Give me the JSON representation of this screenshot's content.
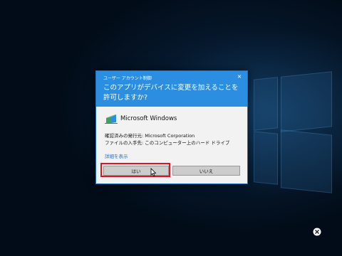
{
  "dialog": {
    "title": "ユーザー アカウント制御",
    "close_label": "×",
    "question": "このアプリがデバイスに変更を加えることを許可しますか?",
    "app_name": "Microsoft Windows",
    "publisher_line": "確認済みの発行元: Microsoft Corporation",
    "origin_line": "ファイルの入手先: このコンピューター上のハード ドライブ",
    "details_link": "詳細を表示",
    "yes_label": "はい",
    "no_label": "いいえ"
  },
  "colors": {
    "header_blue": "#2b8ee0",
    "link_blue": "#1a6fd8",
    "highlight_red": "#e0141e",
    "dialog_bg": "#f2f2f2"
  },
  "icons": {
    "app_icon": "uac-shield-icon",
    "cursor": "mouse-pointer-icon",
    "ease_of_access": "ease-of-access-icon"
  }
}
